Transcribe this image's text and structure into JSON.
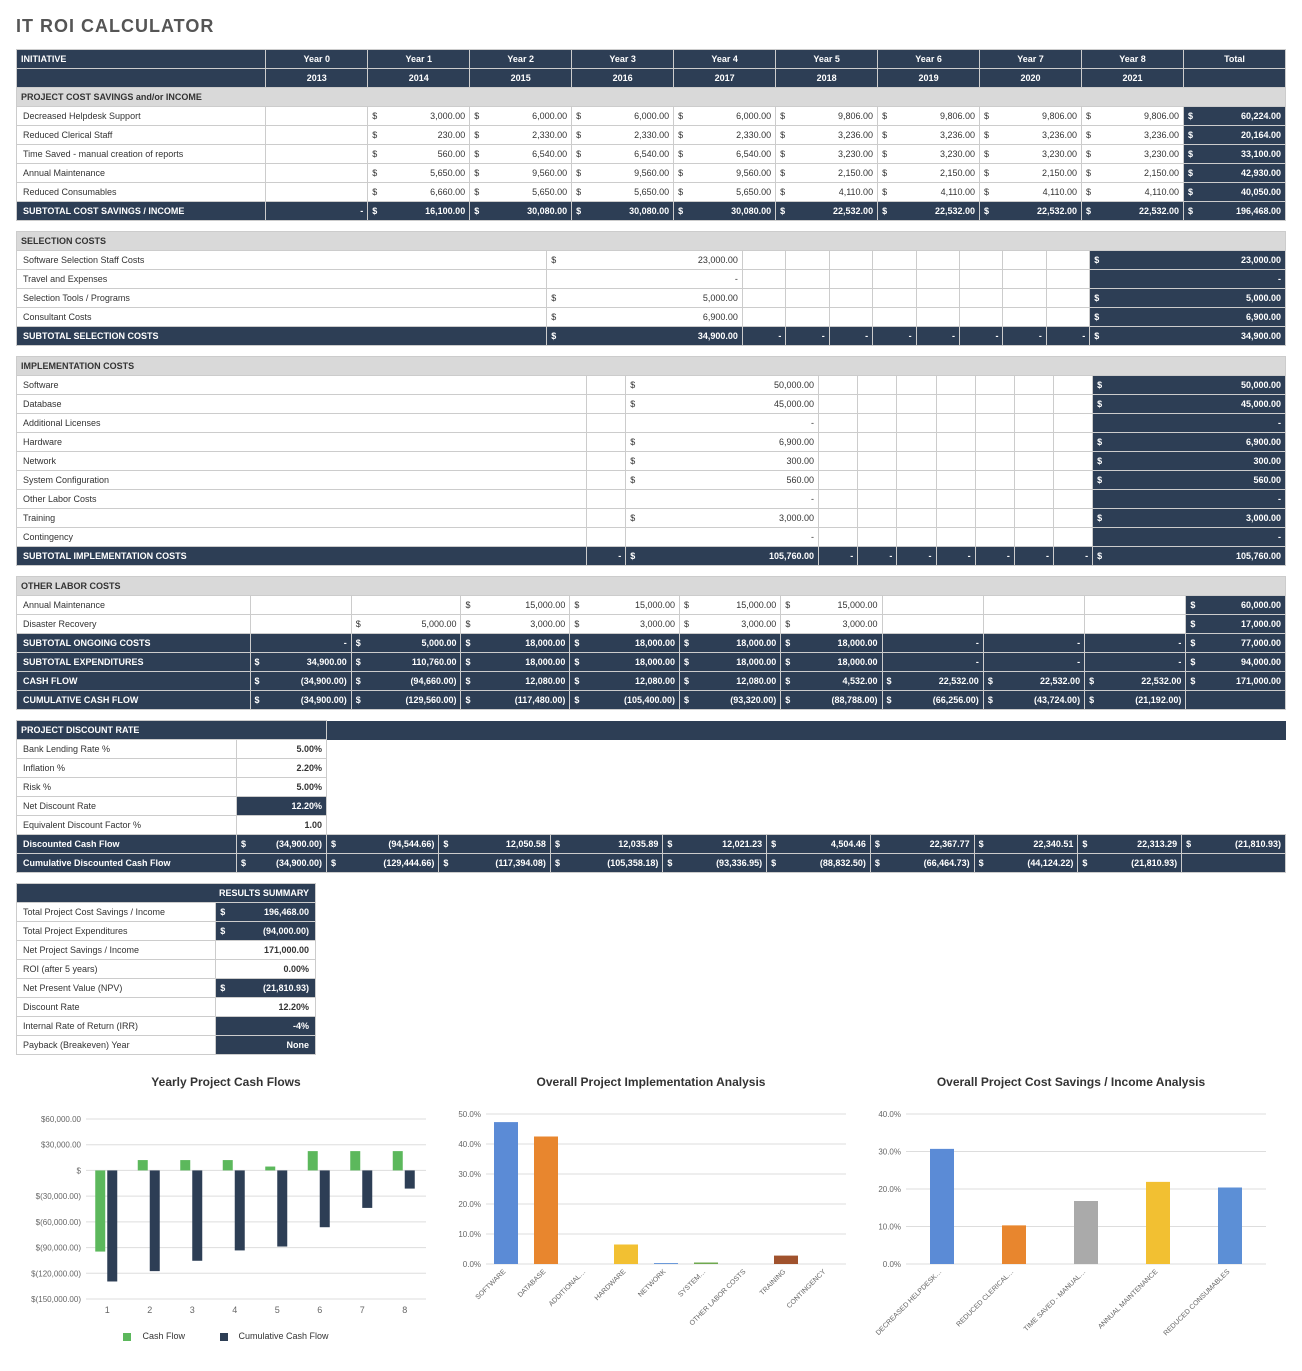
{
  "title": "IT ROI CALCULATOR",
  "headers": {
    "initiative": "INITIATIVE",
    "years": [
      "Year 0",
      "Year 1",
      "Year 2",
      "Year 3",
      "Year 4",
      "Year 5",
      "Year 6",
      "Year 7",
      "Year 8"
    ],
    "year_nums": [
      "2013",
      "2014",
      "2015",
      "2016",
      "2017",
      "2018",
      "2019",
      "2020",
      "2021"
    ],
    "total": "Total"
  },
  "savings": {
    "header": "PROJECT COST SAVINGS and/or INCOME",
    "rows": [
      {
        "label": "Decreased Helpdesk Support",
        "y": [
          "",
          "3,000.00",
          "6,000.00",
          "6,000.00",
          "6,000.00",
          "9,806.00",
          "9,806.00",
          "9,806.00",
          "9,806.00"
        ],
        "total": "60,224.00"
      },
      {
        "label": "Reduced Clerical Staff",
        "y": [
          "",
          "230.00",
          "2,330.00",
          "2,330.00",
          "2,330.00",
          "3,236.00",
          "3,236.00",
          "3,236.00",
          "3,236.00"
        ],
        "total": "20,164.00"
      },
      {
        "label": "Time Saved - manual creation of reports",
        "y": [
          "",
          "560.00",
          "6,540.00",
          "6,540.00",
          "6,540.00",
          "3,230.00",
          "3,230.00",
          "3,230.00",
          "3,230.00"
        ],
        "total": "33,100.00"
      },
      {
        "label": "Annual Maintenance",
        "y": [
          "",
          "5,650.00",
          "9,560.00",
          "9,560.00",
          "9,560.00",
          "2,150.00",
          "2,150.00",
          "2,150.00",
          "2,150.00"
        ],
        "total": "42,930.00"
      },
      {
        "label": "Reduced Consumables",
        "y": [
          "",
          "6,660.00",
          "5,650.00",
          "5,650.00",
          "5,650.00",
          "4,110.00",
          "4,110.00",
          "4,110.00",
          "4,110.00"
        ],
        "total": "40,050.00"
      }
    ],
    "subtotal": {
      "label": "SUBTOTAL COST SAVINGS / INCOME",
      "y": [
        "-",
        "16,100.00",
        "30,080.00",
        "30,080.00",
        "30,080.00",
        "22,532.00",
        "22,532.00",
        "22,532.00",
        "22,532.00"
      ],
      "total": "196,468.00"
    }
  },
  "selection": {
    "header": "SELECTION COSTS",
    "rows": [
      {
        "label": "Software Selection Staff Costs",
        "y": [
          "23,000.00",
          "",
          "",
          "",
          "",
          "",
          "",
          "",
          ""
        ],
        "total": "23,000.00"
      },
      {
        "label": "Travel and Expenses",
        "y": [
          "-",
          "",
          "",
          "",
          "",
          "",
          "",
          "",
          ""
        ],
        "total": "-"
      },
      {
        "label": "Selection Tools / Programs",
        "y": [
          "5,000.00",
          "",
          "",
          "",
          "",
          "",
          "",
          "",
          ""
        ],
        "total": "5,000.00"
      },
      {
        "label": "Consultant Costs",
        "y": [
          "6,900.00",
          "",
          "",
          "",
          "",
          "",
          "",
          "",
          ""
        ],
        "total": "6,900.00"
      }
    ],
    "subtotal": {
      "label": "SUBTOTAL SELECTION COSTS",
      "y": [
        "34,900.00",
        "-",
        "-",
        "-",
        "-",
        "-",
        "-",
        "-",
        "-"
      ],
      "total": "34,900.00"
    }
  },
  "implementation": {
    "header": "IMPLEMENTATION COSTS",
    "rows": [
      {
        "label": "Software",
        "y": [
          "",
          "50,000.00",
          "",
          "",
          "",
          "",
          "",
          "",
          ""
        ],
        "total": "50,000.00"
      },
      {
        "label": "Database",
        "y": [
          "",
          "45,000.00",
          "",
          "",
          "",
          "",
          "",
          "",
          ""
        ],
        "total": "45,000.00"
      },
      {
        "label": "Additional Licenses",
        "y": [
          "",
          "-",
          "",
          "",
          "",
          "",
          "",
          "",
          ""
        ],
        "total": "-"
      },
      {
        "label": "Hardware",
        "y": [
          "",
          "6,900.00",
          "",
          "",
          "",
          "",
          "",
          "",
          ""
        ],
        "total": "6,900.00"
      },
      {
        "label": "Network",
        "y": [
          "",
          "300.00",
          "",
          "",
          "",
          "",
          "",
          "",
          ""
        ],
        "total": "300.00"
      },
      {
        "label": "System Configuration",
        "y": [
          "",
          "560.00",
          "",
          "",
          "",
          "",
          "",
          "",
          ""
        ],
        "total": "560.00"
      },
      {
        "label": "Other Labor Costs",
        "y": [
          "",
          "-",
          "",
          "",
          "",
          "",
          "",
          "",
          ""
        ],
        "total": "-"
      },
      {
        "label": "Training",
        "y": [
          "",
          "3,000.00",
          "",
          "",
          "",
          "",
          "",
          "",
          ""
        ],
        "total": "3,000.00"
      },
      {
        "label": "Contingency",
        "y": [
          "",
          "-",
          "",
          "",
          "",
          "",
          "",
          "",
          ""
        ],
        "total": "-"
      }
    ],
    "subtotal": {
      "label": "SUBTOTAL IMPLEMENTATION COSTS",
      "y": [
        "-",
        "105,760.00",
        "-",
        "-",
        "-",
        "-",
        "-",
        "-",
        "-"
      ],
      "total": "105,760.00"
    }
  },
  "other": {
    "header": "OTHER LABOR COSTS",
    "rows": [
      {
        "label": "Annual Maintenance",
        "y": [
          "",
          "",
          "15,000.00",
          "15,000.00",
          "15,000.00",
          "15,000.00",
          "",
          "",
          ""
        ],
        "total": "60,000.00"
      },
      {
        "label": "Disaster Recovery",
        "y": [
          "",
          "5,000.00",
          "3,000.00",
          "3,000.00",
          "3,000.00",
          "3,000.00",
          "",
          "",
          ""
        ],
        "total": "17,000.00"
      }
    ],
    "subtotals": [
      {
        "label": "SUBTOTAL ONGOING COSTS",
        "y": [
          "-",
          "5,000.00",
          "18,000.00",
          "18,000.00",
          "18,000.00",
          "18,000.00",
          "-",
          "-",
          "-"
        ],
        "total": "77,000.00"
      },
      {
        "label": "SUBTOTAL EXPENDITURES",
        "y": [
          "34,900.00",
          "110,760.00",
          "18,000.00",
          "18,000.00",
          "18,000.00",
          "18,000.00",
          "-",
          "-",
          "-"
        ],
        "total": "94,000.00"
      },
      {
        "label": "CASH FLOW",
        "y": [
          "(34,900.00)",
          "(94,660.00)",
          "12,080.00",
          "12,080.00",
          "12,080.00",
          "4,532.00",
          "22,532.00",
          "22,532.00",
          "22,532.00"
        ],
        "total": "171,000.00"
      },
      {
        "label": "CUMULATIVE CASH FLOW",
        "y": [
          "(34,900.00)",
          "(129,560.00)",
          "(117,480.00)",
          "(105,400.00)",
          "(93,320.00)",
          "(88,788.00)",
          "(66,256.00)",
          "(43,724.00)",
          "(21,192.00)"
        ],
        "total": ""
      }
    ]
  },
  "discount": {
    "header": "PROJECT DISCOUNT RATE",
    "rows": [
      {
        "label": "Bank Lending Rate %",
        "val": "5.00%"
      },
      {
        "label": "Inflation %",
        "val": "2.20%"
      },
      {
        "label": "Risk %",
        "val": "5.00%"
      },
      {
        "label": "Net Discount Rate",
        "val": "12.20%",
        "dark": true
      },
      {
        "label": "Equivalent Discount Factor %",
        "val": "1.00"
      }
    ],
    "dcf": {
      "label": "Discounted Cash Flow",
      "y": [
        "(34,900.00)",
        "(94,544.66)",
        "12,050.58",
        "12,035.89",
        "12,021.23",
        "4,504.46",
        "22,367.77",
        "22,340.51",
        "22,313.29"
      ],
      "total": "(21,810.93)"
    },
    "cdcf": {
      "label": "Cumulative Discounted Cash Flow",
      "y": [
        "(34,900.00)",
        "(129,444.66)",
        "(117,394.08)",
        "(105,358.18)",
        "(93,336.95)",
        "(88,832.50)",
        "(66,464.73)",
        "(44,124.22)",
        "(21,810.93)"
      ],
      "total": ""
    }
  },
  "results": {
    "header": "RESULTS SUMMARY",
    "rows": [
      {
        "label": "Total Project Cost Savings / Income",
        "val": "196,468.00",
        "cur": "$",
        "dark": true
      },
      {
        "label": "Total Project Expenditures",
        "val": "(94,000.00)",
        "cur": "$",
        "dark": true
      },
      {
        "label": "Net Project Savings / Income",
        "val": "171,000.00",
        "cur": "",
        "dark": false,
        "bold": true
      },
      {
        "label": "ROI (after 5 years)",
        "val": "0.00%",
        "dark": false,
        "bold": true
      },
      {
        "label": "Net Present Value (NPV)",
        "val": "(21,810.93)",
        "cur": "$",
        "dark": true
      },
      {
        "label": "Discount Rate",
        "val": "12.20%",
        "dark": false,
        "bold": true
      },
      {
        "label": "Internal Rate of Return (IRR)",
        "val": "-4%",
        "dark": true
      },
      {
        "label": "Payback (Breakeven) Year",
        "val": "None",
        "dark": true
      }
    ]
  },
  "chart_data": [
    {
      "type": "bar",
      "title": "Yearly Project Cash Flows",
      "categories": [
        "1",
        "2",
        "3",
        "4",
        "5",
        "6",
        "7",
        "8"
      ],
      "series": [
        {
          "name": "Cash Flow",
          "color": "#5cb85c",
          "values": [
            -94660,
            12080,
            12080,
            12080,
            4532,
            22532,
            22532,
            22532
          ]
        },
        {
          "name": "Cumulative Cash Flow",
          "color": "#2d3e55",
          "values": [
            -129560,
            -117480,
            -105400,
            -93320,
            -88788,
            -66256,
            -43724,
            -21192
          ]
        }
      ],
      "ylim": [
        -150000,
        60000
      ],
      "yticks": [
        "$60,000.00",
        "$30,000.00",
        "$",
        "$(30,000.00)",
        "$(60,000.00)",
        "$(90,000.00)",
        "$(120,000.00)",
        "$(150,000.00)"
      ]
    },
    {
      "type": "bar",
      "title": "Overall Project Implementation Analysis",
      "categories": [
        "SOFTWARE",
        "DATABASE",
        "ADDITIONAL…",
        "HARDWARE",
        "NETWORK",
        "SYSTEM…",
        "OTHER LABOR COSTS",
        "TRAINING",
        "CONTINGENCY"
      ],
      "values": [
        47.3,
        42.5,
        0,
        6.5,
        0.3,
        0.5,
        0,
        2.8,
        0
      ],
      "colors": [
        "#5b8bd6",
        "#e8862e",
        "#aaa",
        "#f2c032",
        "#5c8fd6",
        "#6fa84f",
        "#355e8e",
        "#a0522d",
        "#777"
      ],
      "ylim": [
        0,
        50
      ],
      "ylabel": "%",
      "yticks": [
        "50.0%",
        "40.0%",
        "30.0%",
        "20.0%",
        "10.0%",
        "0.0%"
      ]
    },
    {
      "type": "bar",
      "title": "Overall Project Cost Savings / Income Analysis",
      "categories": [
        "DECREASED HELPDESK…",
        "REDUCED CLERICAL…",
        "TIME SAVED - MANUAL…",
        "ANNUAL MAINTENANCE",
        "REDUCED CONSUMABLES"
      ],
      "values": [
        30.7,
        10.3,
        16.8,
        21.9,
        20.4
      ],
      "colors": [
        "#5b8bd6",
        "#e8862e",
        "#aaa",
        "#f2c032",
        "#5c8fd6"
      ],
      "ylim": [
        0,
        40
      ],
      "ylabel": "%",
      "yticks": [
        "40.0%",
        "30.0%",
        "20.0%",
        "10.0%",
        "0.0%"
      ]
    }
  ]
}
